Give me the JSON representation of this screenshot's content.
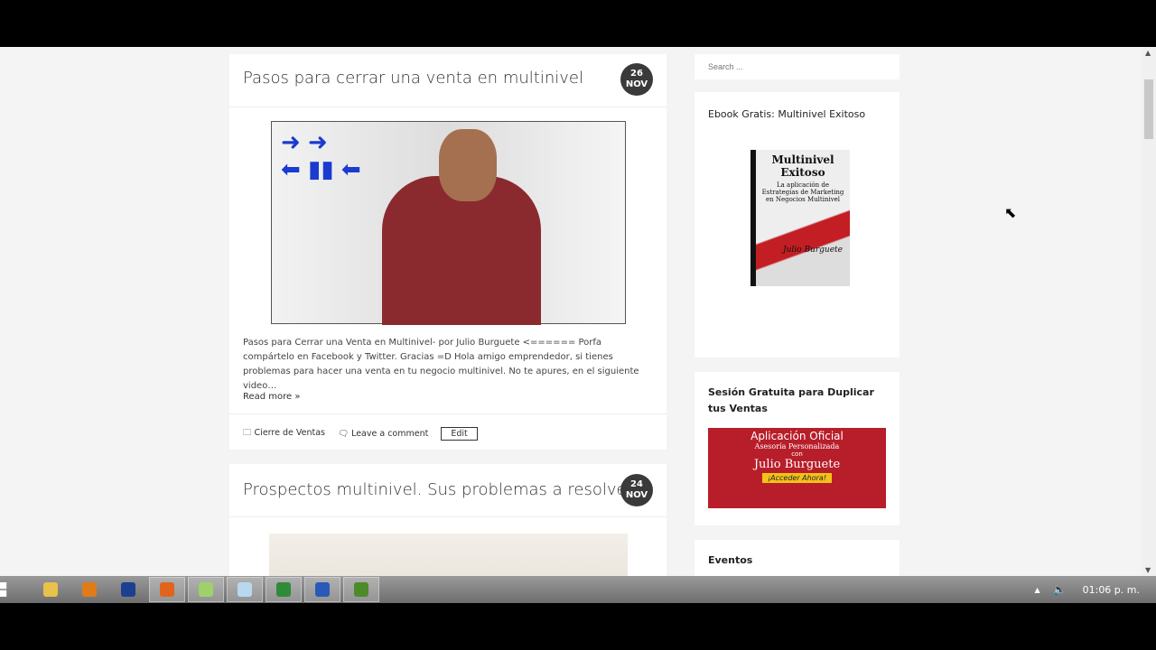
{
  "search": {
    "placeholder": "Search ..."
  },
  "posts": [
    {
      "title": "Pasos para cerrar una venta en multinivel",
      "day": "26",
      "month": "NOV",
      "excerpt": "Pasos para Cerrar una Venta en Multinivel- por Julio Burguete <====== Porfa compártelo en Facebook y Twitter. Gracias =D Hola amigo emprendedor, si tienes problemas para hacer una venta en tu negocio multinivel. No te apures, en el siguiente video…",
      "read_more": "Read more »",
      "category": "Cierre de Ventas",
      "comment": "Leave a comment",
      "edit": "Edit"
    },
    {
      "title": "Prospectos multinivel. Sus problemas a resolver.",
      "day": "24",
      "month": "NOV"
    }
  ],
  "widgets": {
    "ebook": {
      "title": "Ebook Gratis: Multinivel Exitoso",
      "cover_title": "Multinivel Exitoso",
      "cover_subtitle": "La aplicación de Estrategias de Marketing en Negocios Multinivel",
      "cover_author": "Julio Burguete"
    },
    "session": {
      "title": "Sesión Gratuita para Duplicar tus Ventas",
      "banner_l1": "Aplicación Oficial",
      "banner_l2": "Asesoría Personalizada",
      "banner_l3": "con",
      "banner_l4": "Julio Burguete",
      "banner_cta": "¡Acceder Ahora!"
    },
    "events": {
      "title": "Eventos"
    }
  },
  "taskbar": {
    "clock": "01:06 p. m.",
    "apps": [
      {
        "name": "explorer",
        "color": "#e8c24a"
      },
      {
        "name": "app-orange",
        "color": "#e07b1a"
      },
      {
        "name": "photoshop",
        "color": "#1c3f8f"
      },
      {
        "name": "firefox",
        "color": "#e0641c"
      },
      {
        "name": "folder-app",
        "color": "#9fd06a"
      },
      {
        "name": "notepad",
        "color": "#b9d8ee"
      },
      {
        "name": "excel",
        "color": "#2f8a3a"
      },
      {
        "name": "word",
        "color": "#2a5ab8"
      },
      {
        "name": "excel-2",
        "color": "#4d8a2a"
      }
    ]
  }
}
